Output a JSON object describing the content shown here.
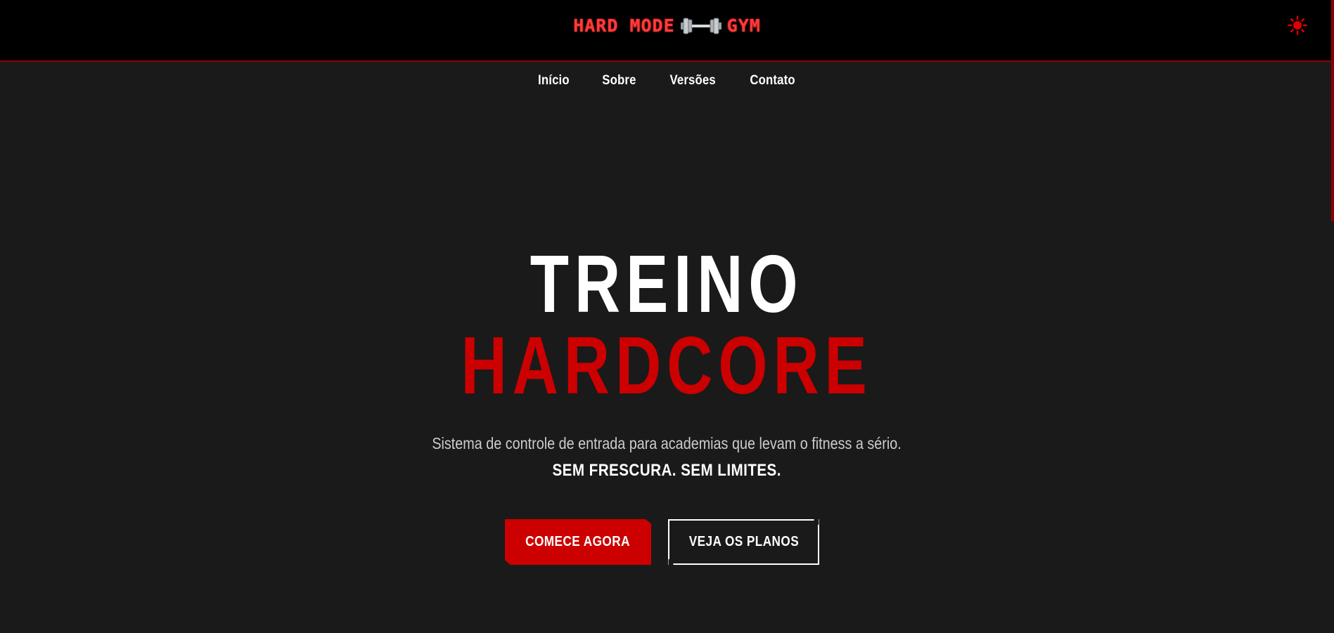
{
  "header": {
    "logo_left": "HARD MODE",
    "logo_right": "GYM",
    "logo_icon": "dumbbell-icon",
    "theme_icon": "sun-icon",
    "accent_color": "#ff3b3b"
  },
  "nav": {
    "items": [
      {
        "label": "Início"
      },
      {
        "label": "Sobre"
      },
      {
        "label": "Versões"
      },
      {
        "label": "Contato"
      }
    ]
  },
  "hero": {
    "title_line1": "TREINO",
    "title_line2": "HARDCORE",
    "title_line2_color": "#cc0000",
    "subtitle": "Sistema de controle de entrada para academias que levam o fitness a sério.",
    "tagline": "SEM FRESCURA. SEM LIMITES.",
    "primary_button": "COMECE AGORA",
    "secondary_button": "VEJA OS PLANOS"
  }
}
